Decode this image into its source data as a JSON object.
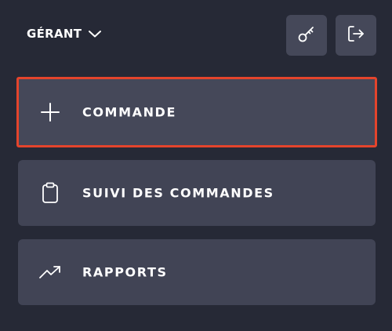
{
  "header": {
    "role_label": "GÉRANT",
    "role_icon": "chevron-down-icon",
    "key_button_icon": "key-icon",
    "logout_button_icon": "logout-icon"
  },
  "menu": {
    "items": [
      {
        "label": "COMMANDE",
        "icon": "plus-icon",
        "selected": true
      },
      {
        "label": "SUIVI DES COMMANDES",
        "icon": "clipboard-icon",
        "selected": false
      },
      {
        "label": "RAPPORTS",
        "icon": "trending-up-icon",
        "selected": false
      }
    ]
  },
  "colors": {
    "background": "#262936",
    "card": "#414455",
    "button": "#454859",
    "selection_outline": "#e4442c",
    "text": "#ffffff"
  }
}
